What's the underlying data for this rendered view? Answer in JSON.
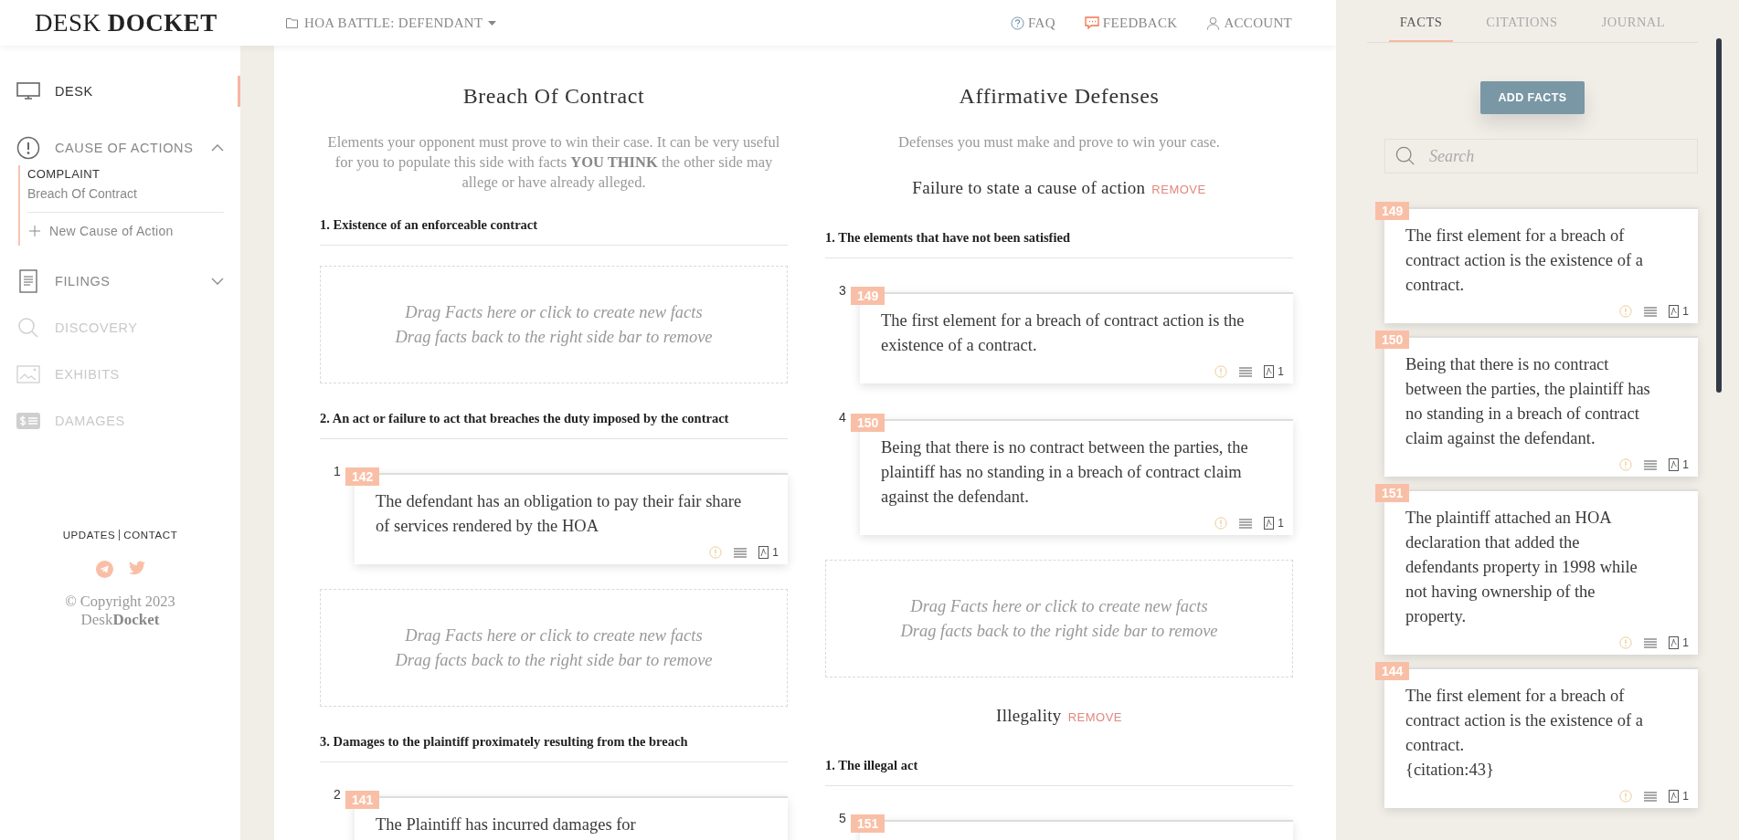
{
  "header": {
    "logo": "DESK **DOCKET**",
    "case_menu": {
      "label": "HOA BATTLE: DEFENDANT"
    },
    "nav": [
      {
        "label": "FAQ"
      },
      {
        "label": "FEEDBACK"
      },
      {
        "label": "ACCOUNT"
      }
    ]
  },
  "sidebar": {
    "items": [
      {
        "label": "DESK",
        "selected": true,
        "disabled": false
      },
      {
        "label": "CAUSE OF ACTIONS",
        "selected": false,
        "disabled": false,
        "expanded": true,
        "groups": [
          {
            "heading": "COMPLAINT",
            "items": [
              {
                "label": "Breach Of Contract"
              }
            ]
          }
        ],
        "add_label": "New Cause of Action"
      },
      {
        "label": "FILINGS",
        "selected": false,
        "disabled": false,
        "expanded": false
      },
      {
        "label": "DISCOVERY",
        "selected": false,
        "disabled": true
      },
      {
        "label": "EXHIBITS",
        "selected": false,
        "disabled": true
      },
      {
        "label": "DAMAGES",
        "selected": false,
        "disabled": true
      }
    ],
    "footer_links": [
      "UPDATES",
      "CONTACT"
    ],
    "copyright": "© Copyright 2023",
    "brand": "Desk**Docket**"
  },
  "board": {
    "columns": [
      {
        "title": "Breach Of Contract",
        "description": "Elements your opponent must prove to win their case. It can be very useful for you to populate this side with facts **YOU THINK** the other side may allege or have already alleged.",
        "sections": [
          {
            "elements": [
              {
                "title": "1. Existence of an enforceable contract",
                "items": [
                  {
                    "kind": "dropzone",
                    "lines": [
                      "Drag Facts here or click to create new facts",
                      "Drag facts back to the right side bar to remove"
                    ]
                  }
                ]
              },
              {
                "title": "2. An act or failure to act that breaches the duty imposed by the contract",
                "items": [
                  {
                    "kind": "fact",
                    "number": "1",
                    "id": "142",
                    "text": "The defendant has an obligation to pay their fair share of services rendered by the HOA",
                    "attachments": "1"
                  },
                  {
                    "kind": "dropzone",
                    "lines": [
                      "Drag Facts here or click to create new facts",
                      "Drag facts back to the right side bar to remove"
                    ]
                  }
                ]
              },
              {
                "title": "3. Damages to the plaintiff proximately resulting from the breach",
                "items": [
                  {
                    "kind": "fact",
                    "number": "2",
                    "id": "141",
                    "text": "The Plaintiff has incurred damages for"
                  }
                ]
              }
            ]
          }
        ]
      },
      {
        "title": "Affirmative Defenses",
        "description": "Defenses you must make and prove to win your case.",
        "sections": [
          {
            "title": "Failure to state a cause of action",
            "remove_label": "REMOVE",
            "elements": [
              {
                "title": "1. The elements that have not been satisfied",
                "items": [
                  {
                    "kind": "fact",
                    "number": "3",
                    "id": "149",
                    "text": "The first element for a breach of contract action is the existence of a contract.",
                    "attachments": "1"
                  },
                  {
                    "kind": "fact",
                    "number": "4",
                    "id": "150",
                    "text": "Being that there is no contract between the parties, the plaintiff has no standing in a breach of contract claim against the defendant.",
                    "attachments": "1"
                  },
                  {
                    "kind": "dropzone",
                    "lines": [
                      "Drag Facts here or click to create new facts",
                      "Drag facts back to the right side bar to remove"
                    ]
                  }
                ]
              }
            ]
          },
          {
            "title": "Illegality",
            "remove_label": "REMOVE",
            "elements": [
              {
                "title": "1. The illegal act",
                "items": [
                  {
                    "kind": "fact",
                    "number": "5",
                    "id": "151"
                  }
                ]
              }
            ]
          }
        ]
      }
    ]
  },
  "facts_panel": {
    "tabs": [
      {
        "label": "FACTS",
        "selected": true
      },
      {
        "label": "CITATIONS",
        "selected": false
      },
      {
        "label": "JOURNAL",
        "selected": false
      }
    ],
    "add_button": "ADD FACTS",
    "search": {
      "placeholder": "Search"
    },
    "facts": [
      {
        "id": "149",
        "text": "The first element for a breach of contract action is the existence of a contract.",
        "attachments": "1"
      },
      {
        "id": "150",
        "text": "Being that there is no contract between the parties, the plaintiff has no standing in a breach of contract claim against the defendant.",
        "attachments": "1"
      },
      {
        "id": "151",
        "text": "The plaintiff attached an HOA declaration that added the defendants property in 1998 while not having ownership of the property.",
        "attachments": "1"
      },
      {
        "id": "144",
        "text": "The first element for a breach of contract action is the existence of a contract.",
        "citation": "{citation:43}",
        "attachments": "1"
      }
    ]
  }
}
